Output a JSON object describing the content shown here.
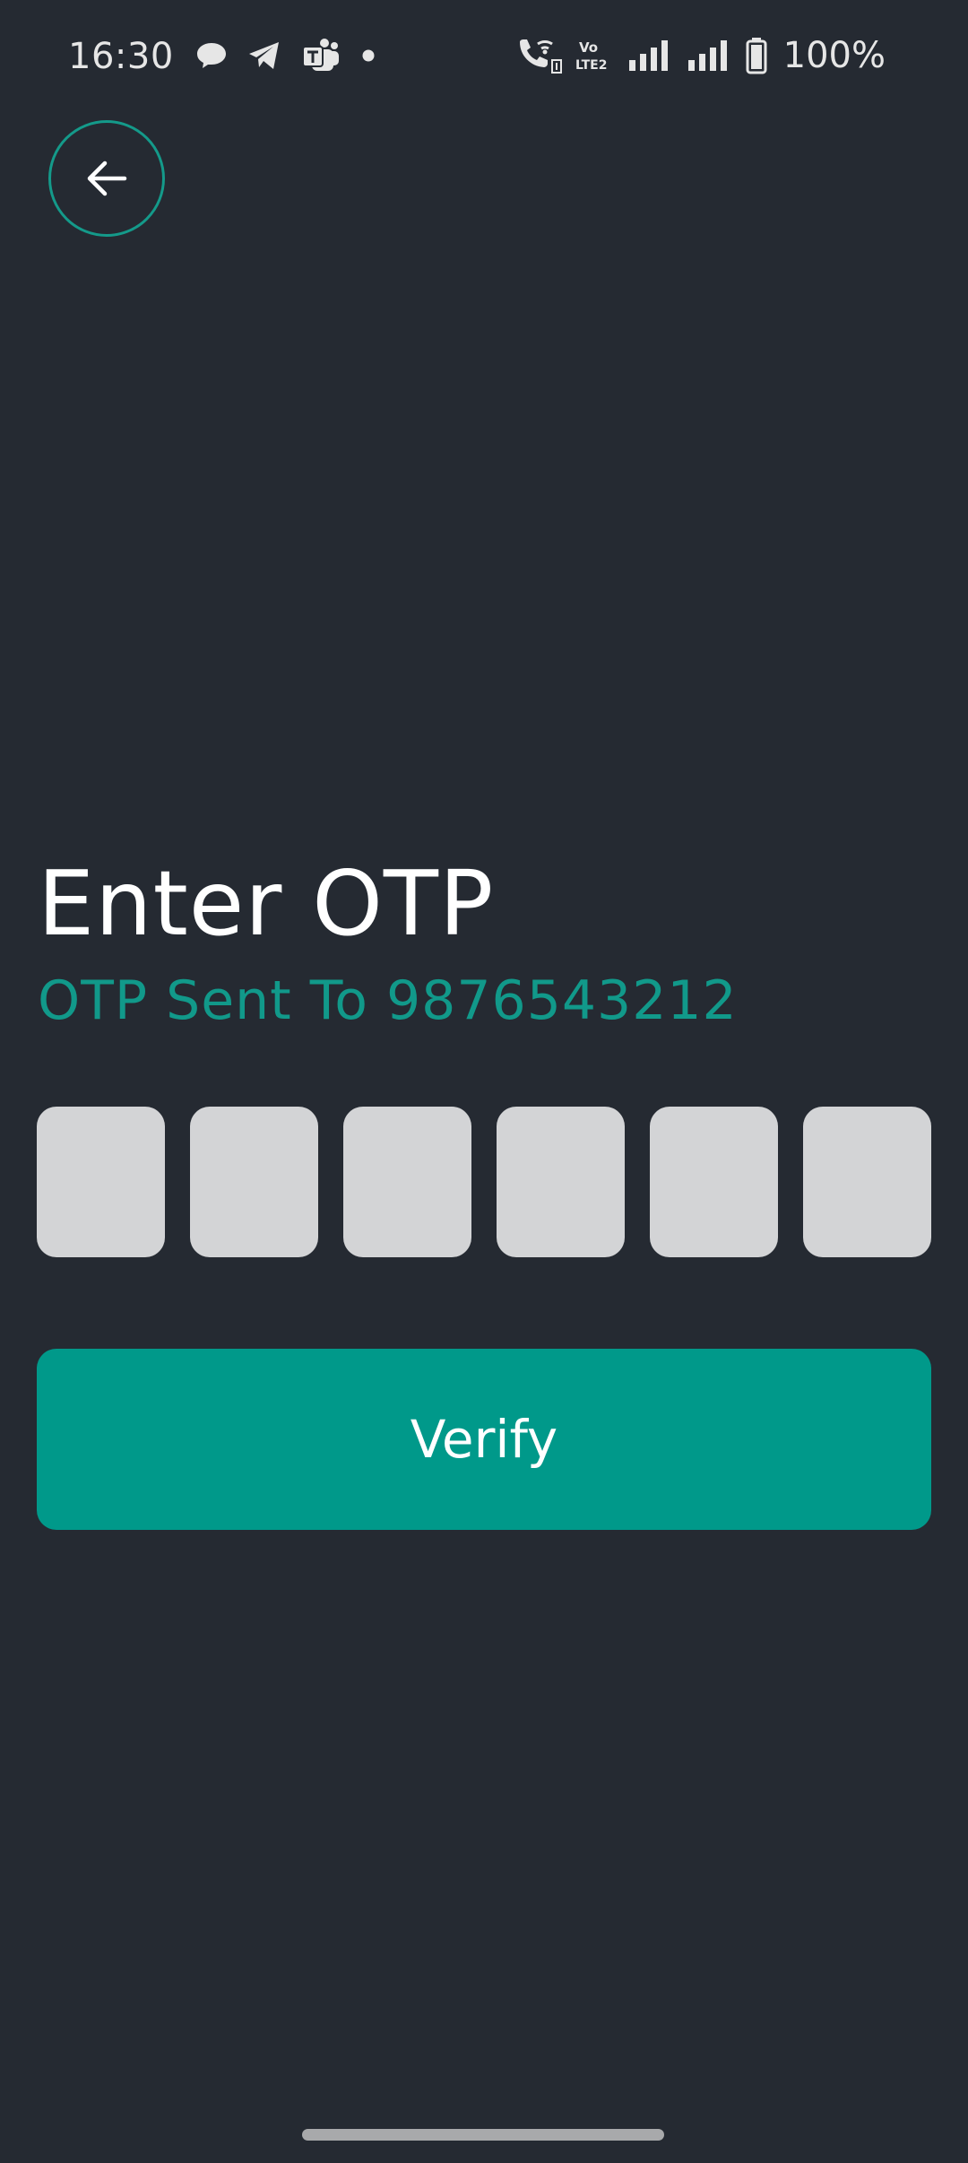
{
  "status_bar": {
    "time": "16:30",
    "battery": "100%",
    "left_icons": [
      "chat-bubble-icon",
      "telegram-icon",
      "teams-icon",
      "dot-icon"
    ],
    "right_icons": [
      "wifi-calling-icon",
      "volte-icon",
      "signal-icon",
      "signal-icon",
      "battery-icon"
    ]
  },
  "header": {
    "back_icon": "arrow-left-icon"
  },
  "main": {
    "title": "Enter OTP",
    "subtitle": "OTP Sent To 9876543212",
    "otp_digits": [
      "",
      "",
      "",
      "",
      "",
      ""
    ],
    "verify_label": "Verify"
  },
  "colors": {
    "background": "#252a32",
    "accent": "#00998a",
    "otp_box": "#d3d4d6",
    "text": "#ffffff"
  }
}
